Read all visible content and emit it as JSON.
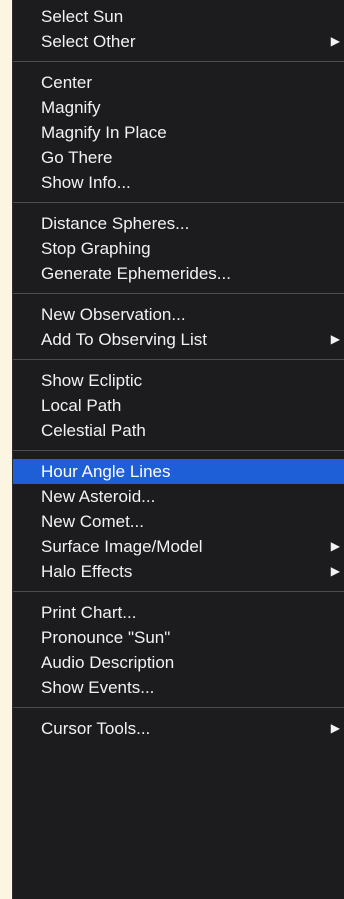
{
  "menu": {
    "groups": [
      {
        "items": [
          {
            "label": "Select Sun",
            "submenu": false
          },
          {
            "label": "Select Other",
            "submenu": true
          }
        ]
      },
      {
        "items": [
          {
            "label": "Center",
            "submenu": false
          },
          {
            "label": "Magnify",
            "submenu": false
          },
          {
            "label": "Magnify In Place",
            "submenu": false
          },
          {
            "label": "Go There",
            "submenu": false
          },
          {
            "label": "Show Info...",
            "submenu": false
          }
        ]
      },
      {
        "items": [
          {
            "label": "Distance Spheres...",
            "submenu": false
          },
          {
            "label": "Stop Graphing",
            "submenu": false
          },
          {
            "label": "Generate Ephemerides...",
            "submenu": false
          }
        ]
      },
      {
        "items": [
          {
            "label": "New Observation...",
            "submenu": false
          },
          {
            "label": "Add To Observing List",
            "submenu": true
          }
        ]
      },
      {
        "items": [
          {
            "label": "Show Ecliptic",
            "submenu": false
          },
          {
            "label": "Local Path",
            "submenu": false
          },
          {
            "label": "Celestial Path",
            "submenu": false
          }
        ]
      },
      {
        "items": [
          {
            "label": "Hour Angle Lines",
            "submenu": false,
            "highlighted": true
          },
          {
            "label": "New Asteroid...",
            "submenu": false
          },
          {
            "label": "New Comet...",
            "submenu": false
          },
          {
            "label": "Surface Image/Model",
            "submenu": true
          },
          {
            "label": "Halo Effects",
            "submenu": true
          }
        ]
      },
      {
        "items": [
          {
            "label": "Print Chart...",
            "submenu": false
          },
          {
            "label": "Pronounce \"Sun\"",
            "submenu": false
          },
          {
            "label": "Audio Description",
            "submenu": false
          },
          {
            "label": "Show Events...",
            "submenu": false
          }
        ]
      },
      {
        "items": [
          {
            "label": "Cursor Tools...",
            "submenu": true
          }
        ]
      }
    ],
    "submenu_glyph": "▶",
    "colors": {
      "background": "#1c1b1e",
      "highlight": "#1e5ed6",
      "text": "#f2f2f2",
      "separator": "#4c4b50",
      "page_background": "#fcf5e2"
    }
  }
}
